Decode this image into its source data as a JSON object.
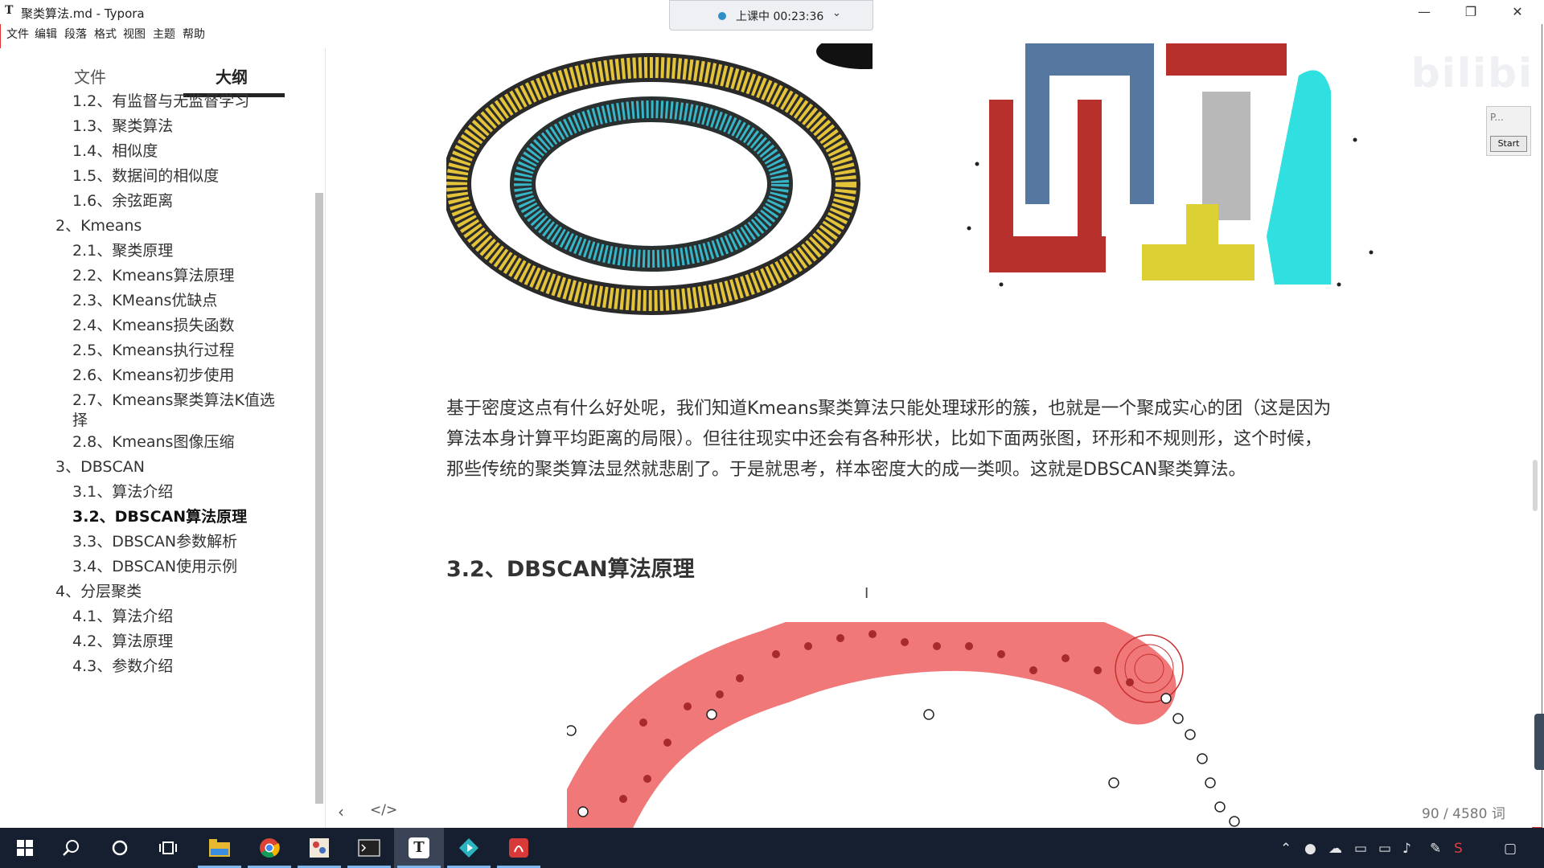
{
  "window": {
    "title": "聚类算法.md - Typora",
    "app_icon": "T",
    "min_glyph": "—",
    "max_glyph": "❐",
    "close_glyph": "✕",
    "accent_color": "#dd3333"
  },
  "meeting": {
    "status": "上课中 00:23:36",
    "chevron": "⌄"
  },
  "menubar": [
    "文件",
    "编辑",
    "段落",
    "格式",
    "视图",
    "主题",
    "帮助"
  ],
  "sidebar": {
    "tab_files": "文件",
    "tab_outline": "大纲",
    "items": [
      {
        "label": "1.2、有监督与无监督学习"
      },
      {
        "label": "1.3、聚类算法"
      },
      {
        "label": "1.4、相似度"
      },
      {
        "label": "1.5、数据间的相似度"
      },
      {
        "label": "1.6、余弦距离"
      },
      {
        "label": "2、Kmeans"
      },
      {
        "label": "2.1、聚类原理"
      },
      {
        "label": "2.2、Kmeans算法原理"
      },
      {
        "label": "2.3、KMeans优缺点"
      },
      {
        "label": "2.4、Kmeans损失函数"
      },
      {
        "label": "2.5、Kmeans执行过程"
      },
      {
        "label": "2.6、Kmeans初步使用"
      },
      {
        "label": "2.7、Kmeans聚类算法K值选"
      },
      {
        "label": "择"
      },
      {
        "label": "2.8、Kmeans图像压缩"
      },
      {
        "label": "3、DBSCAN"
      },
      {
        "label": "3.1、算法介绍"
      },
      {
        "label": "3.2、DBSCAN算法原理"
      },
      {
        "label": "3.3、DBSCAN参数解析"
      },
      {
        "label": "3.4、DBSCAN使用示例"
      },
      {
        "label": "4、分层聚类"
      },
      {
        "label": "4.1、算法介绍"
      },
      {
        "label": "4.2、算法原理"
      },
      {
        "label": "4.3、参数介绍"
      }
    ]
  },
  "content": {
    "paragraph_lines": [
      "基于密度这点有什么好处呢，我们知道Kmeans聚类算法只能处理球形的簇，也就是一个聚成实心的团（这是因为",
      "算法本身计算平均距离的局限）。但往往现实中还会有各种形状，比如下面两张图，环形和不规则形，这个时候，",
      "那些传统的聚类算法显然就悲剧了。于是就思考，样本密度大的成一类呗。这就是DBSCAN聚类算法。"
    ],
    "heading": "3.2、DBSCAN算法原理",
    "cursor_glyph": "I",
    "watermark": "bilibili",
    "colors": {
      "ring_outer": "#e3c33a",
      "ring_inner": "#36b6c8",
      "cluster_red": "#b8302c",
      "cluster_blue": "#5577a0",
      "cluster_yellow": "#dcd034",
      "cluster_cyan": "#30e0e0",
      "cluster_gray": "#b8b8b8",
      "dbscan_band": "#f07878",
      "dbscan_point": "#a82a2a"
    }
  },
  "mini_panel": {
    "title": "P...",
    "start_label": "Start"
  },
  "status": {
    "nav_back": "‹",
    "source_toggle": "</>",
    "word_count": "90 / 4580 词"
  },
  "taskbar": {
    "icons": [
      "windows-start-icon",
      "search-icon",
      "cortana-icon",
      "task-view-icon",
      "file-explorer-icon",
      "chrome-icon",
      "paint-icon",
      "terminal-icon",
      "typora-icon",
      "app-diamond-icon",
      "pdf-icon"
    ],
    "typora_label": "T",
    "tray_icons": [
      "chevron-up-icon",
      "people-icon",
      "onedrive-icon",
      "usb-icon",
      "network-icon",
      "volume-icon",
      "pen-icon",
      "sogou-icon",
      "notification-icon"
    ]
  }
}
